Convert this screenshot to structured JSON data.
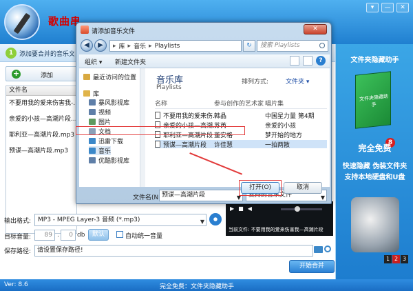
{
  "app": {
    "title": "歌曲串烧制作软件",
    "version": "Ver: 8.6",
    "status_free": "完全免费：文件夹隐藏助手",
    "win_controls": [
      "▾",
      "—",
      "✕"
    ]
  },
  "step": {
    "number": "1",
    "text": "添加要合并的音乐文"
  },
  "left_panel": {
    "add_label": "添加",
    "list_header": "文件名",
    "items": [
      "不要用我的爱来伤害我-...",
      "亲爱的小孩—高潮片段...",
      "耶利亚—高潮片段.mp3",
      "预谋—高潮片段.mp3"
    ]
  },
  "form": {
    "format_label": "输出格式:",
    "format_value": "MP3 - MPEG Layer-3 音频 (*.mp3)",
    "volume_label": "目标音量:",
    "volume_value1": "89",
    "volume_value2": "0",
    "volume_unit1": ".",
    "volume_unit2": "db",
    "default_label": "默认",
    "auto_label": "自动统一音量",
    "path_label": "保存路径:",
    "path_value": "请设置保存路径!",
    "merge_label": "开始合并"
  },
  "banner": {
    "title": "文件夹隐藏助手",
    "box_text": "文件夹隐藏助手",
    "badge": "8",
    "free": "完全免费",
    "line1": "快速隐藏 伪装文件夹",
    "line2": "支持本地硬盘和U盘",
    "pages": [
      "1",
      "2",
      "3"
    ]
  },
  "player": {
    "now_playing": "当前文件: 不要用我的爱来伤害我—高潮片段"
  },
  "dialog": {
    "title": "请添加音乐文件",
    "close": "✕",
    "breadcrumb": [
      "库",
      "音乐",
      "Playlists"
    ],
    "search_placeholder": "搜索 Playlists",
    "toolbar": {
      "organize": "组织 ▾",
      "new_folder": "新建文件夹"
    },
    "nav": [
      {
        "label": "最近访问的位置",
        "color": "#d9a940"
      },
      {
        "label": "库",
        "color": "#e0b44a"
      },
      {
        "label": "暴风影视库",
        "color": "#5f7fa8"
      },
      {
        "label": "视频",
        "color": "#5f7fa8"
      },
      {
        "label": "图片",
        "color": "#5f9a5f"
      },
      {
        "label": "文档",
        "color": "#8aa0b8"
      },
      {
        "label": "迅雷下载",
        "color": "#3b88c9"
      },
      {
        "label": "音乐",
        "color": "#3b88c9"
      },
      {
        "label": "优酷影视库",
        "color": "#5f7fa8"
      }
    ],
    "library_title": "音乐库",
    "library_sub": "Playlists",
    "arrange_label": "排列方式:",
    "arrange_value": "文件夹 ▾",
    "columns": [
      "名称",
      "参与创作的艺术家",
      "唱片集"
    ],
    "rows": [
      {
        "name": "不要用我的爱来伤...",
        "artist": "韩晶",
        "album": "中国星力量 第4期"
      },
      {
        "name": "亲爱的小孩—高潮...",
        "artist": "苏芮",
        "album": "亲爱的小孩"
      },
      {
        "name": "耶利亚—高潮片段",
        "artist": "董安格",
        "album": "梦开始的地方"
      },
      {
        "name": "预谋—高潮片段",
        "artist": "许佳慧",
        "album": "一拍两散"
      }
    ],
    "filename_label": "文件名(N):",
    "filename_value": "预谋—高潮片段",
    "filetype_value": "支持的音乐文件",
    "open_label": "打开(O)",
    "cancel_label": "取消"
  },
  "colors": {
    "accent": "#2a80d4",
    "highlight": "#e23a3a"
  }
}
